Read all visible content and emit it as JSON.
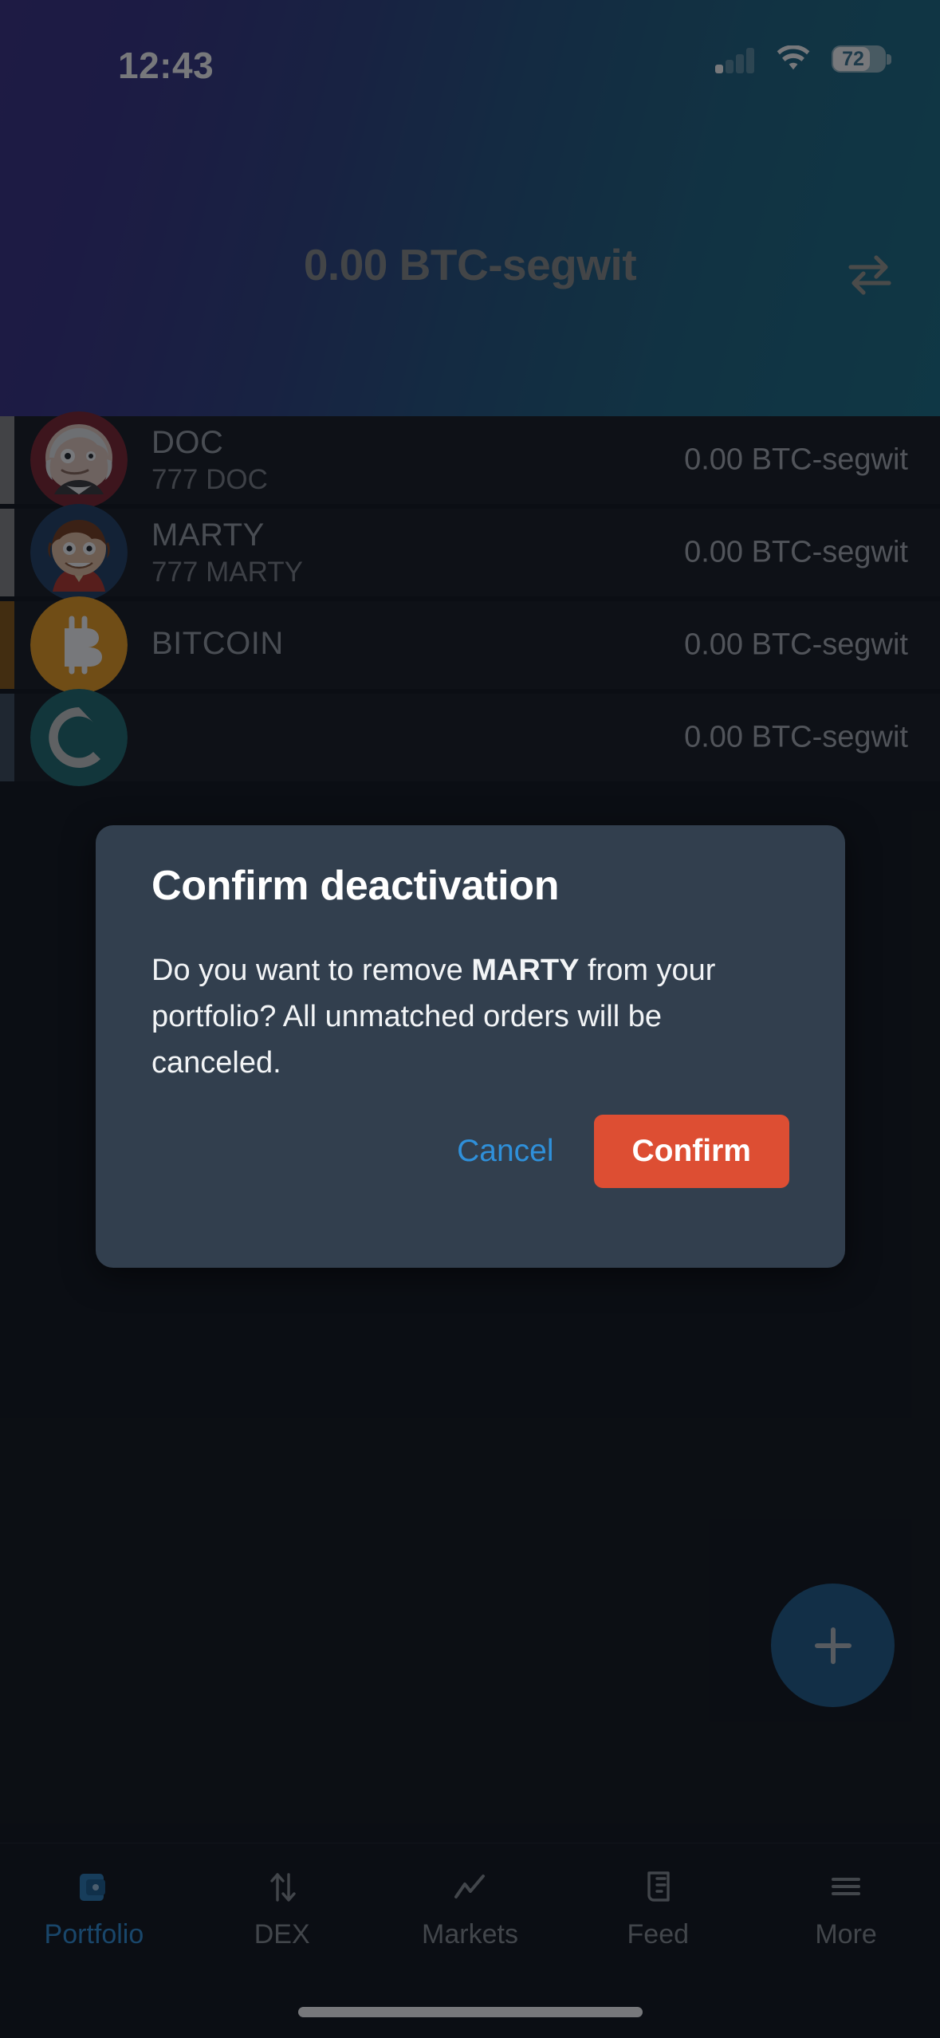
{
  "status_bar": {
    "time": "12:43",
    "battery_percent": "72",
    "signal_icon": "cellular-signal-icon",
    "wifi_icon": "wifi-icon",
    "battery_icon": "battery-icon"
  },
  "header": {
    "balance": "0.00 BTC-segwit",
    "swap_icon": "swap-arrows-icon",
    "gradient_from": "#3a3186",
    "gradient_to": "#1a7087"
  },
  "assets": [
    {
      "name": "DOC",
      "amount": "777 DOC",
      "value": "0.00 BTC-segwit",
      "accent": "#8a8a8a",
      "avatar_icon": "doc-avatar-icon"
    },
    {
      "name": "MARTY",
      "amount": "777 MARTY",
      "value": "0.00 BTC-segwit",
      "accent": "#8a8a8a",
      "avatar_icon": "marty-avatar-icon"
    },
    {
      "name": "BITCOIN",
      "amount": "",
      "value": "0.00 BTC-segwit",
      "accent": "#8a5a14",
      "avatar_icon": "bitcoin-avatar-icon"
    },
    {
      "name": "",
      "amount": "",
      "value": "0.00 BTC-segwit",
      "accent": "#3c4d5c",
      "avatar_icon": "komodo-avatar-icon"
    }
  ],
  "modal": {
    "title": "Confirm deactivation",
    "body_prefix": "Do you want to remove ",
    "body_asset": "MARTY",
    "body_suffix": " from your portfolio? All unmatched orders will be canceled.",
    "cancel_label": "Cancel",
    "confirm_label": "Confirm",
    "cancel_color": "#2f90da",
    "confirm_color": "#dd4e33"
  },
  "fab": {
    "label": "add-asset",
    "icon": "plus-icon",
    "color": "#1f5e8c"
  },
  "tabbar": {
    "active": "Portfolio",
    "active_color": "#2f90da",
    "items": [
      {
        "label": "Portfolio",
        "icon": "wallet-icon"
      },
      {
        "label": "DEX",
        "icon": "up-down-arrows-icon"
      },
      {
        "label": "Markets",
        "icon": "line-chart-icon"
      },
      {
        "label": "Feed",
        "icon": "document-list-icon"
      },
      {
        "label": "More",
        "icon": "hamburger-menu-icon"
      }
    ]
  }
}
